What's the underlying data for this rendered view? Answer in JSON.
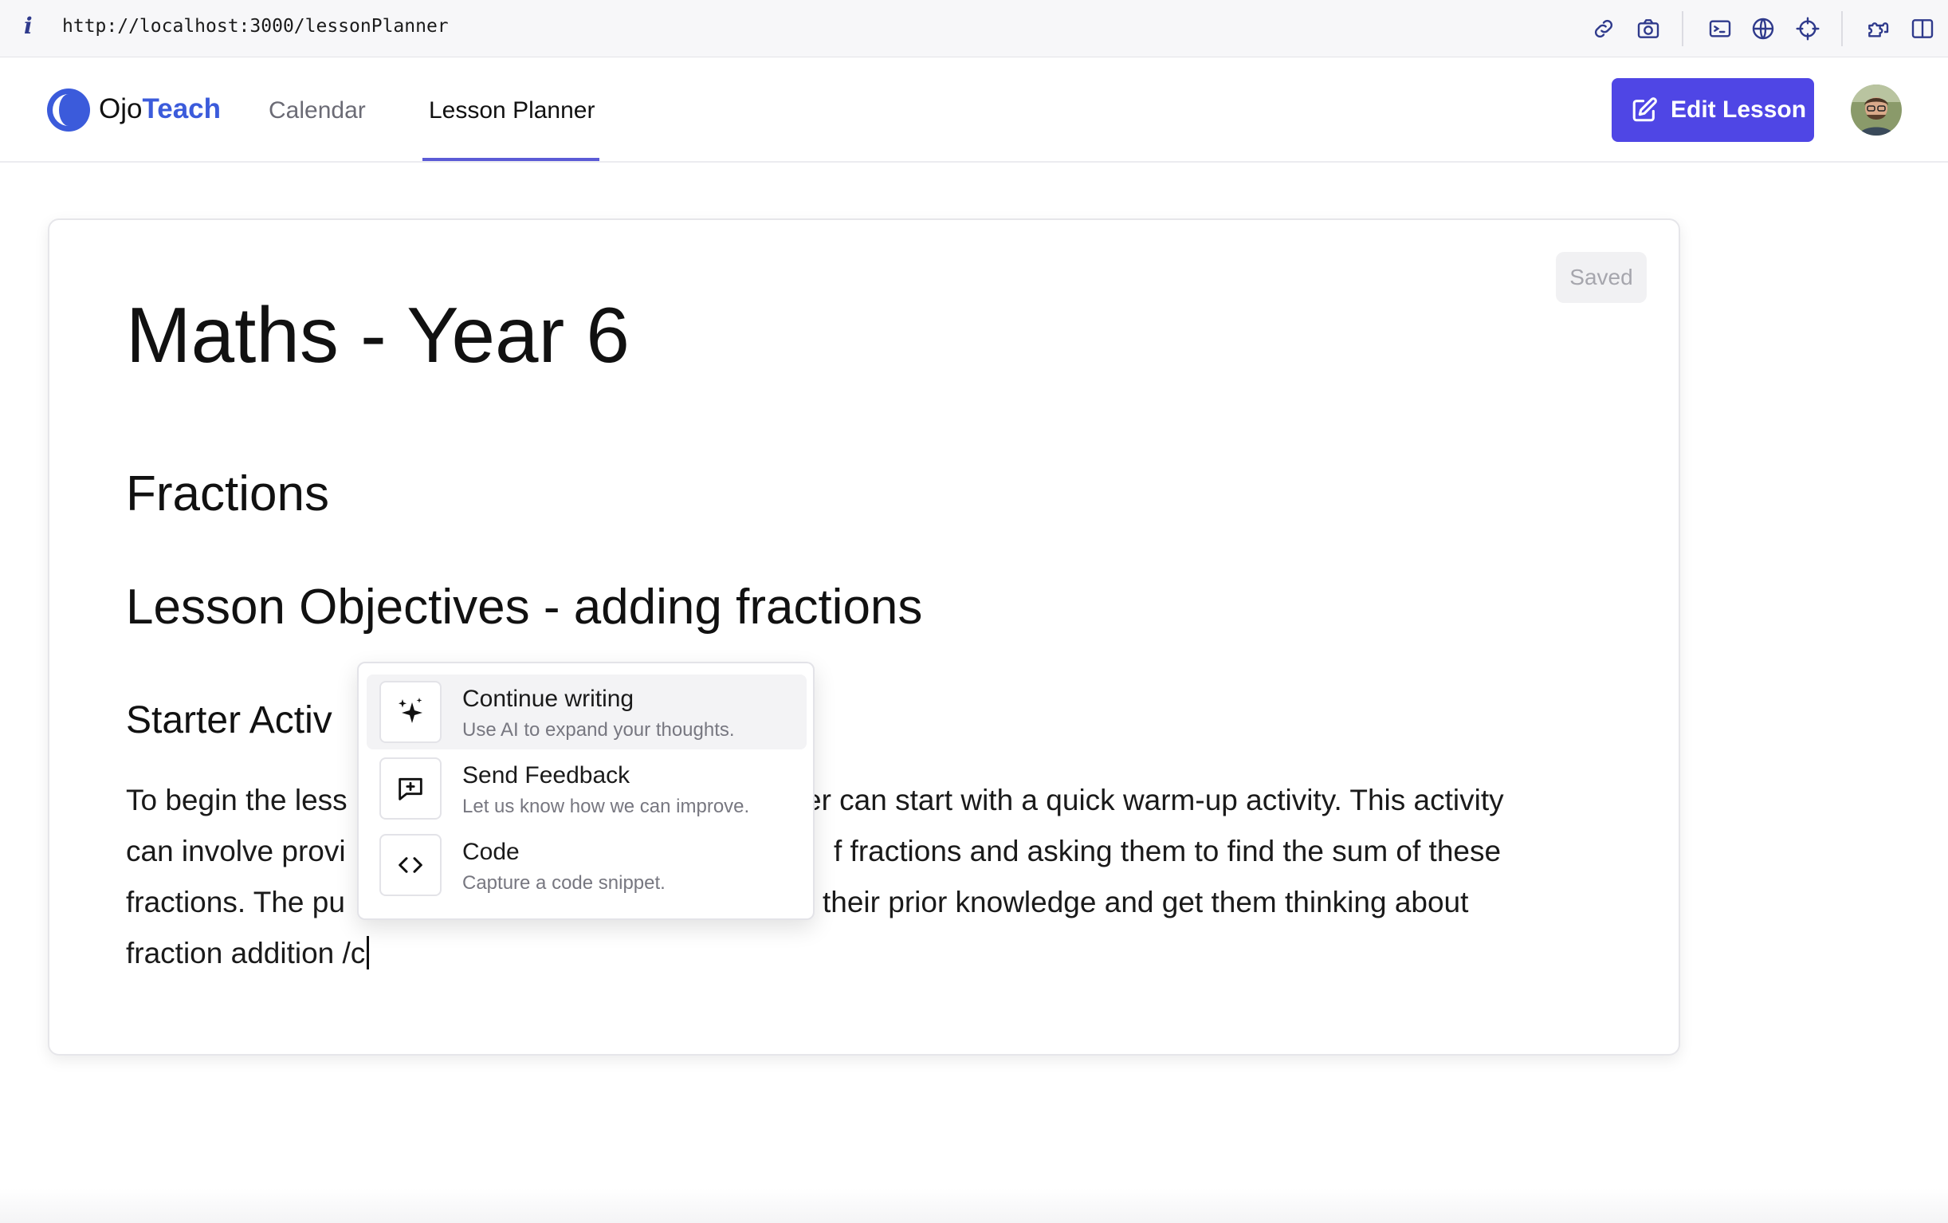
{
  "browser": {
    "info_icon": "i",
    "url": "http://localhost:3000/lessonPlanner",
    "tools": [
      "link-icon",
      "camera-icon",
      "terminal-icon",
      "globe-icon",
      "crosshair-icon",
      "extensions-icon",
      "sidebar-icon"
    ]
  },
  "header": {
    "logo": {
      "part1": "Ojo",
      "part2": "Teach"
    },
    "nav": [
      {
        "label": "Calendar",
        "active": false
      },
      {
        "label": "Lesson Planner",
        "active": true
      }
    ],
    "edit_button_label": "Edit Lesson",
    "accent_color": "#4f46e5"
  },
  "editor": {
    "status": "Saved",
    "title": "Maths - Year 6",
    "subtitle": "Fractions",
    "objectives_heading": "Lesson Objectives - adding fractions",
    "starter_heading": "Starter Activ",
    "paragraph_lines": [
      "To begin the less",
      "er can start with a quick warm-up activity. This activity",
      "can involve provi",
      "f fractions and asking them to find the sum of these",
      "fractions. The pu",
      "their prior knowledge and get them thinking about",
      "fraction addition /c"
    ]
  },
  "slash_menu": {
    "items": [
      {
        "title": "Continue writing",
        "description": "Use AI to expand your thoughts.",
        "icon": "sparkles-icon",
        "selected": true
      },
      {
        "title": "Send Feedback",
        "description": "Let us know how we can improve.",
        "icon": "message-plus-icon",
        "selected": false
      },
      {
        "title": "Code",
        "description": "Capture a code snippet.",
        "icon": "code-icon",
        "selected": false
      }
    ]
  }
}
